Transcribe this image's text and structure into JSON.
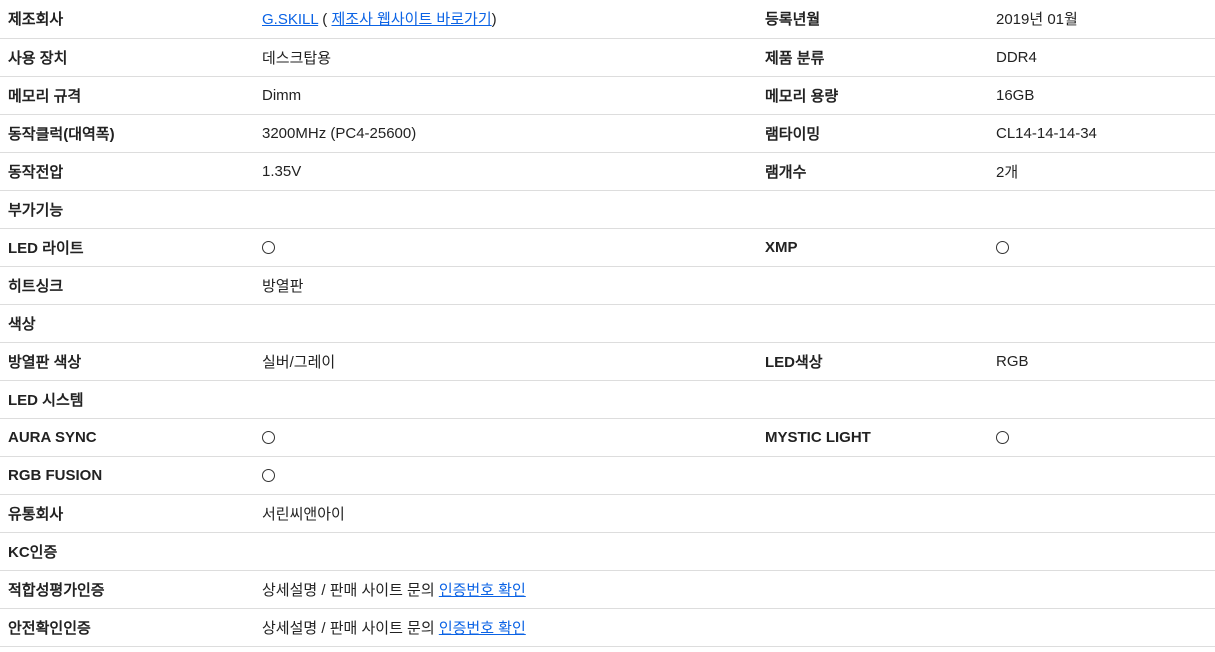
{
  "rows": [
    {
      "label": "제조회사",
      "value_parts": [
        {
          "link": "G.SKILL"
        },
        {
          "text": " ( "
        },
        {
          "link": "제조사 웹사이트 바로가기"
        },
        {
          "text": ")"
        }
      ],
      "label2": "등록년월",
      "value2": "2019년 01월"
    },
    {
      "label": "사용 장치",
      "value": "데스크탑용",
      "label2": "제품 분류",
      "value2": "DDR4"
    },
    {
      "label": "메모리 규격",
      "value": "Dimm",
      "label2": "메모리 용량",
      "value2": "16GB"
    },
    {
      "label": "동작클럭(대역폭)",
      "value": "3200MHz (PC4-25600)",
      "label2": "램타이밍",
      "value2": "CL14-14-14-34"
    },
    {
      "label": "동작전압",
      "value": "1.35V",
      "label2": "램개수",
      "value2": "2개"
    },
    {
      "label": "부가기능"
    },
    {
      "label": "LED 라이트",
      "value_icon": "circle-yes-icon",
      "label2": "XMP",
      "value2_icon": "circle-yes-icon"
    },
    {
      "label": "히트싱크",
      "value": "방열판"
    },
    {
      "label": "색상"
    },
    {
      "label": "방열판 색상",
      "value": "실버/그레이",
      "label2": "LED색상",
      "value2": "RGB"
    },
    {
      "label": "LED 시스템"
    },
    {
      "label": "AURA SYNC",
      "value_icon": "circle-yes-icon",
      "label2": "MYSTIC LIGHT",
      "value2_icon": "circle-yes-icon"
    },
    {
      "label": "RGB FUSION",
      "value_icon": "circle-yes-icon"
    },
    {
      "label": "유통회사",
      "value": "서린씨앤아이"
    },
    {
      "label": "KC인증"
    },
    {
      "label": "적합성평가인증",
      "value_parts": [
        {
          "text": "상세설명 / 판매 사이트 문의 "
        },
        {
          "link": "인증번호 확인"
        }
      ]
    },
    {
      "label": "안전확인인증",
      "value_parts": [
        {
          "text": "상세설명 / 판매 사이트 문의 "
        },
        {
          "link": "인증번호 확인"
        }
      ]
    }
  ]
}
